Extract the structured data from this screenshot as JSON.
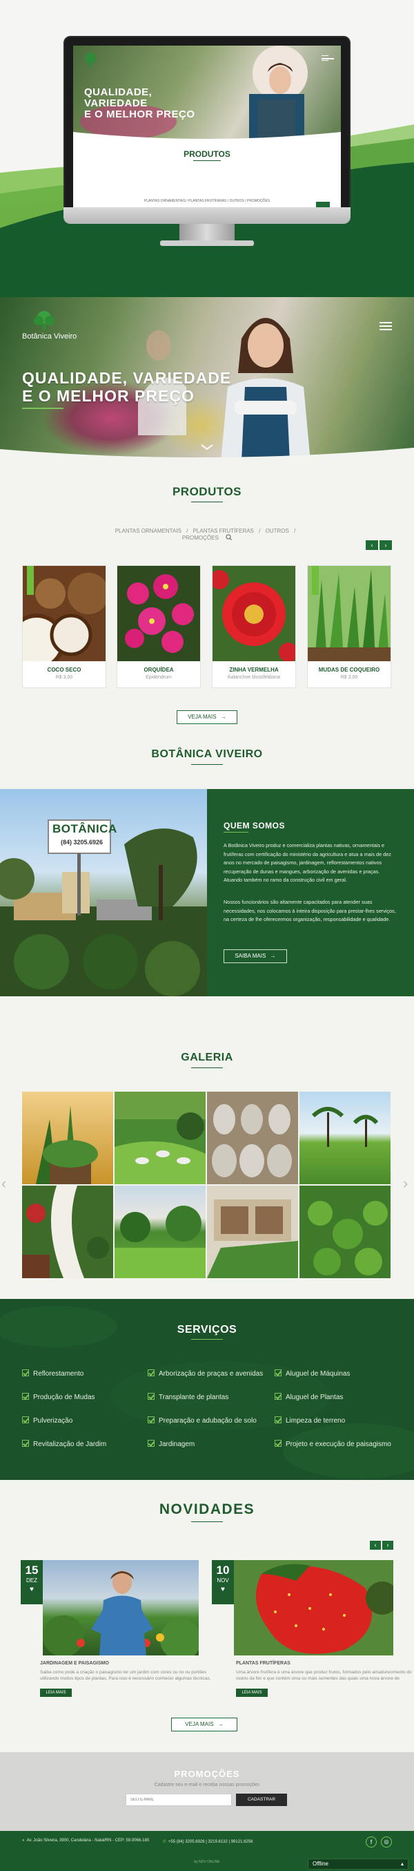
{
  "brand": {
    "logo_text": "Botânica Viveiro",
    "green": "#1e5b2d",
    "accent": "#7fc15a"
  },
  "mockup": {
    "hero_title_line1": "QUALIDADE, VARIEDADE",
    "hero_title_line2": "E O MELHOR PREÇO",
    "products_title": "PRODUTOS",
    "menu": "PLANTAS ORNAMENTAIS  /  PLANTAS FRUTÍFERAS  /  OUTROS  /  PROMOÇÕES"
  },
  "hero": {
    "title_line1": "QUALIDADE, VARIEDADE",
    "title_line2": "E O MELHOR PREÇO",
    "menu_icon": "hamburger-icon",
    "scroll_icon": "chevron-down-icon"
  },
  "products": {
    "title": "PRODUTOS",
    "categories": [
      "PLANTAS ORNAMENTAIS",
      "PLANTAS FRUTÍFERAS",
      "OUTROS",
      "PROMOÇÕES"
    ],
    "separator": "/",
    "items": [
      {
        "name": "COCO SECO",
        "sub": "R$ 3,00"
      },
      {
        "name": "ORQUÍDEA",
        "sub": "Epidendrum"
      },
      {
        "name": "ZINHA VERMELHA",
        "sub": "Kalanchoe blossfeldiana"
      },
      {
        "name": "MUDAS DE COQUEIRO",
        "sub": "R$ 3,00"
      }
    ],
    "more_label": "VEJA MAIS"
  },
  "about": {
    "section_title": "BOTÂNICA VIVEIRO",
    "sign_text": "BOTÂNICA",
    "sign_phone": "(84) 3205.6926",
    "heading": "QUEM SOMOS",
    "p1": "A Botânica Viveiro produz e comercializa plantas nativas, ornamentais e frutíferas com certificação do ministério da agricultura e atua a mais de dez anos no mercado de paisagismo, jardinagem, reflorestamentos nativos recuperação de dunas e mangues, arborização de avenidas e praças. Atuando também no ramo da construção civil em geral.",
    "p2": "Nossos funcionários são altamente capacitados para atender suas necessidades, nos colocamos à inteira disposição para prestar-lhes serviços, na certeza de lhe oferecermos organização, responsabilidade e qualidade.",
    "button_label": "SAIBA MAIS"
  },
  "gallery": {
    "title": "GALERIA"
  },
  "services": {
    "title": "SERVIÇOS",
    "col1": [
      "Reflorestamento",
      "Produção de Mudas",
      "Pulverização",
      "Revitalização de Jardim"
    ],
    "col2": [
      "Arborização de praças e avenidas",
      "Transplante de plantas",
      "Preparação e adubação de solo",
      "Jardinagem"
    ],
    "col3": [
      "Aluguel de Máquinas",
      "Aluguel de Plantas",
      "Limpeza de terreno",
      "Projeto e execução de paisagismo"
    ]
  },
  "news": {
    "title": "NOVIDADES",
    "items": [
      {
        "day": "15",
        "month": "DEZ",
        "title": "JARDINAGEM E PAISAGISMO",
        "text": "Saiba como pode a criação o paisagismo ter um jardim com cores ou no ou portões utilizando muitos tipos de plantas. Para isso é necessário conhecer algumas técnicas.",
        "button": "LEIA MAIS"
      },
      {
        "day": "10",
        "month": "NOV",
        "title": "PLANTAS FRUTÍFERAS",
        "text": "Uma árvore frutífera é uma árvore que produz frutos, formados pelo amadurecimento do ovário da flor e que contém uma ou mais sementes das quais uma nova árvore de",
        "button": "LEIA MAIS"
      }
    ],
    "more_label": "VEJA MAIS"
  },
  "promo": {
    "title": "PROMOÇÕES",
    "subtitle": "Cadastre seu e-mail e receba nossas promoções",
    "email_placeholder": "SEU E-MAIL",
    "button_label": "CADASTRAR"
  },
  "footer": {
    "address": "Av. João Silveira, 3900, Candelária - Natal/RN - CEP: 59.0066-180",
    "phones": "+55 (84) 3205.6926 | 3219.6132 | 99121.6256",
    "credit": "by NDV ONLINE",
    "chat_label": "Offline"
  }
}
